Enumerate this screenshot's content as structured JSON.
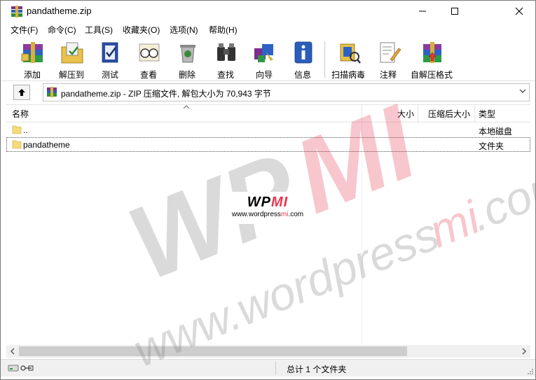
{
  "window": {
    "title": "pandatheme.zip"
  },
  "menu": [
    "文件(F)",
    "命令(C)",
    "工具(S)",
    "收藏夹(O)",
    "选项(N)",
    "帮助(H)"
  ],
  "toolbar": {
    "add": "添加",
    "extract": "解压到",
    "test": "测试",
    "view": "查看",
    "delete": "删除",
    "find": "查找",
    "wizard": "向导",
    "info": "信息",
    "scan": "扫描病毒",
    "comment": "注释",
    "sfx": "自解压格式"
  },
  "address": {
    "text": "pandatheme.zip - ZIP 压缩文件, 解包大小为 70,943 字节"
  },
  "columns": {
    "name": "名称",
    "size": "大小",
    "packed": "压缩后大小",
    "type": "类型"
  },
  "rows": [
    {
      "name": "..",
      "type": "本地磁盘"
    },
    {
      "name": "pandatheme",
      "type": "文件夹"
    }
  ],
  "status": {
    "text": "总计 1 个文件夹"
  },
  "watermark": {
    "brand_left": "WP",
    "brand_right": "MI",
    "url_left": "www.wordpress",
    "url_mid": "mi",
    "url_right": ".com"
  },
  "colors": {
    "accent_pink": "#e8364f",
    "folder_yellow": "#f5d97a",
    "window_bg": "#ffffff"
  }
}
